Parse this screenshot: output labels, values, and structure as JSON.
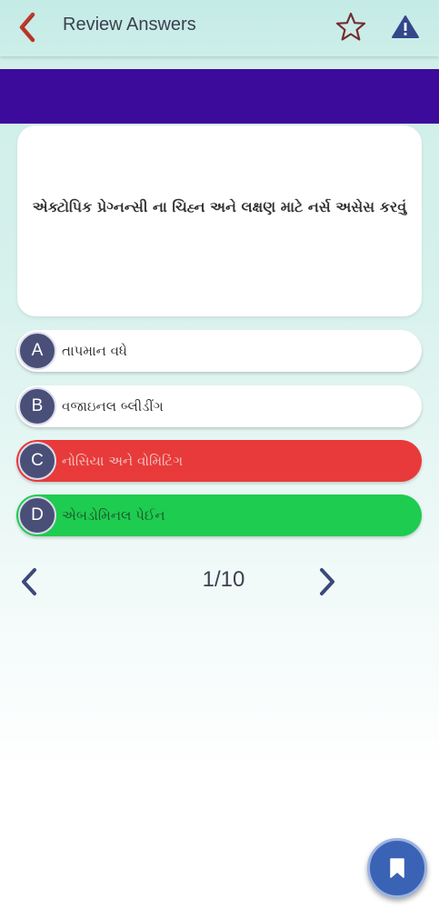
{
  "header": {
    "title": "Review Answers",
    "back_icon": "chevron-left-icon",
    "star_icon": "star-outline-icon",
    "report_icon": "warning-icon"
  },
  "question": {
    "text": "એક્ટોપિક પ્રેગ્નન્સી ના ચિહ્ન અને લક્ષણ માટે નર્સ અસેસ કરવું"
  },
  "options": [
    {
      "letter": "A",
      "text": "તાપમાન વધે",
      "state": "neutral"
    },
    {
      "letter": "B",
      "text": "વજાઇનલ બ્લીડીંગ",
      "state": "neutral"
    },
    {
      "letter": "C",
      "text": "નોસિયા અને વોમિટિંગ",
      "state": "wrong",
      "color": "#e83a3a"
    },
    {
      "letter": "D",
      "text": "એબડોમિનલ પેઈન",
      "state": "correct",
      "color": "#1ecc50"
    }
  ],
  "navigation": {
    "page": "1/10",
    "prev_icon": "chevron-left-icon",
    "next_icon": "chevron-right-icon"
  },
  "fab": {
    "icon": "bookmark-icon"
  },
  "colors": {
    "banner": "#3d0b9b",
    "accent_red": "#c0392b",
    "nav_blue": "#3b4a7a"
  }
}
